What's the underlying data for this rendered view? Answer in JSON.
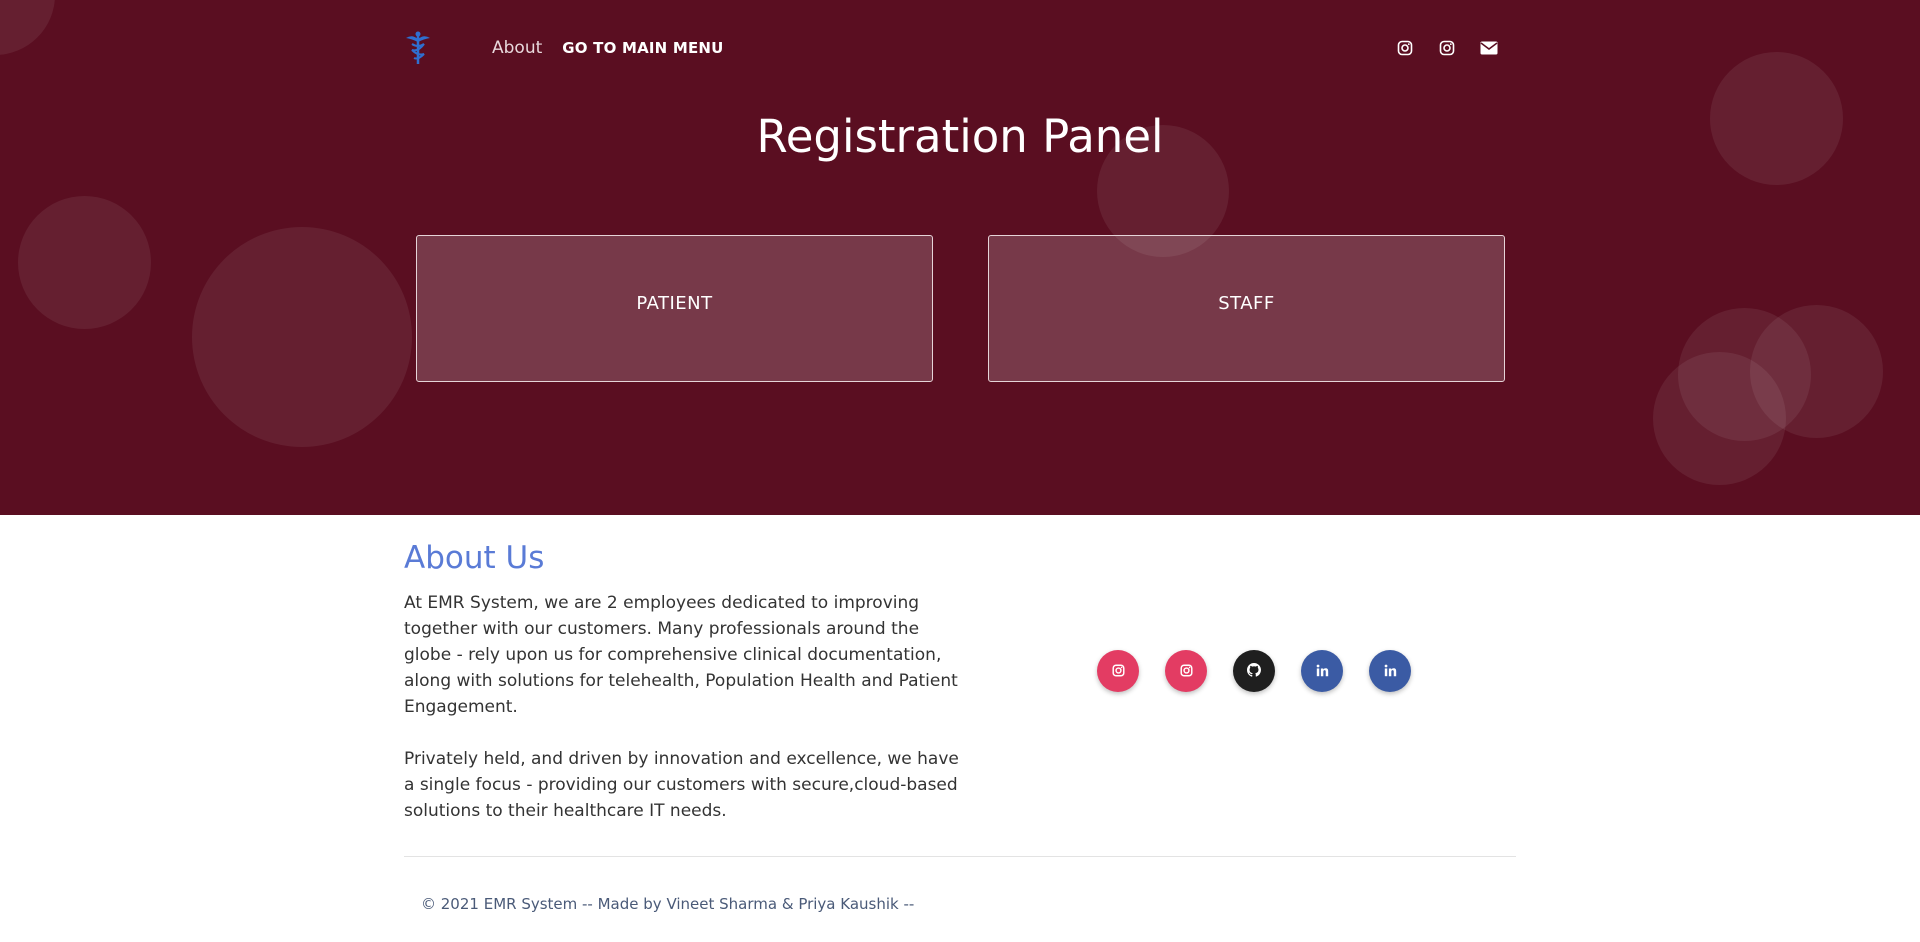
{
  "nav": {
    "logo_icon": "caduceus-icon",
    "about_label": "About",
    "main_menu_label": "GO TO MAIN MENU",
    "icons": [
      "instagram-icon",
      "instagram-icon",
      "envelope-icon"
    ]
  },
  "hero": {
    "title": "Registration Panel",
    "background_color": "#5a0e21",
    "cards": [
      {
        "label": "PATIENT"
      },
      {
        "label": "STAFF"
      }
    ]
  },
  "about": {
    "heading": "About Us",
    "paragraphs": [
      "At EMR System, we are 2 employees dedicated to improving together with our customers. Many professionals around the globe - rely upon us for comprehensive clinical documentation, along with solutions for telehealth, Population Health and Patient Engagement.",
      "Privately held, and driven by innovation and excellence, we have a single focus - providing our customers with secure,cloud-based solutions to their healthcare IT needs."
    ],
    "heading_color": "#5a7bd6"
  },
  "socials": [
    {
      "icon": "instagram-icon",
      "color": "#e33c63"
    },
    {
      "icon": "instagram-icon",
      "color": "#e33c63"
    },
    {
      "icon": "github-icon",
      "color": "#1f1f1f"
    },
    {
      "icon": "linkedin-icon",
      "color": "#3b5ba4"
    },
    {
      "icon": "linkedin-icon",
      "color": "#3b5ba4"
    }
  ],
  "footer": {
    "copyright": "© 2021 EMR System -- Made by ",
    "author1": "Vineet Sharma",
    "amp": " & ",
    "author2": "Priya Kaushik",
    "suffix": " --"
  }
}
